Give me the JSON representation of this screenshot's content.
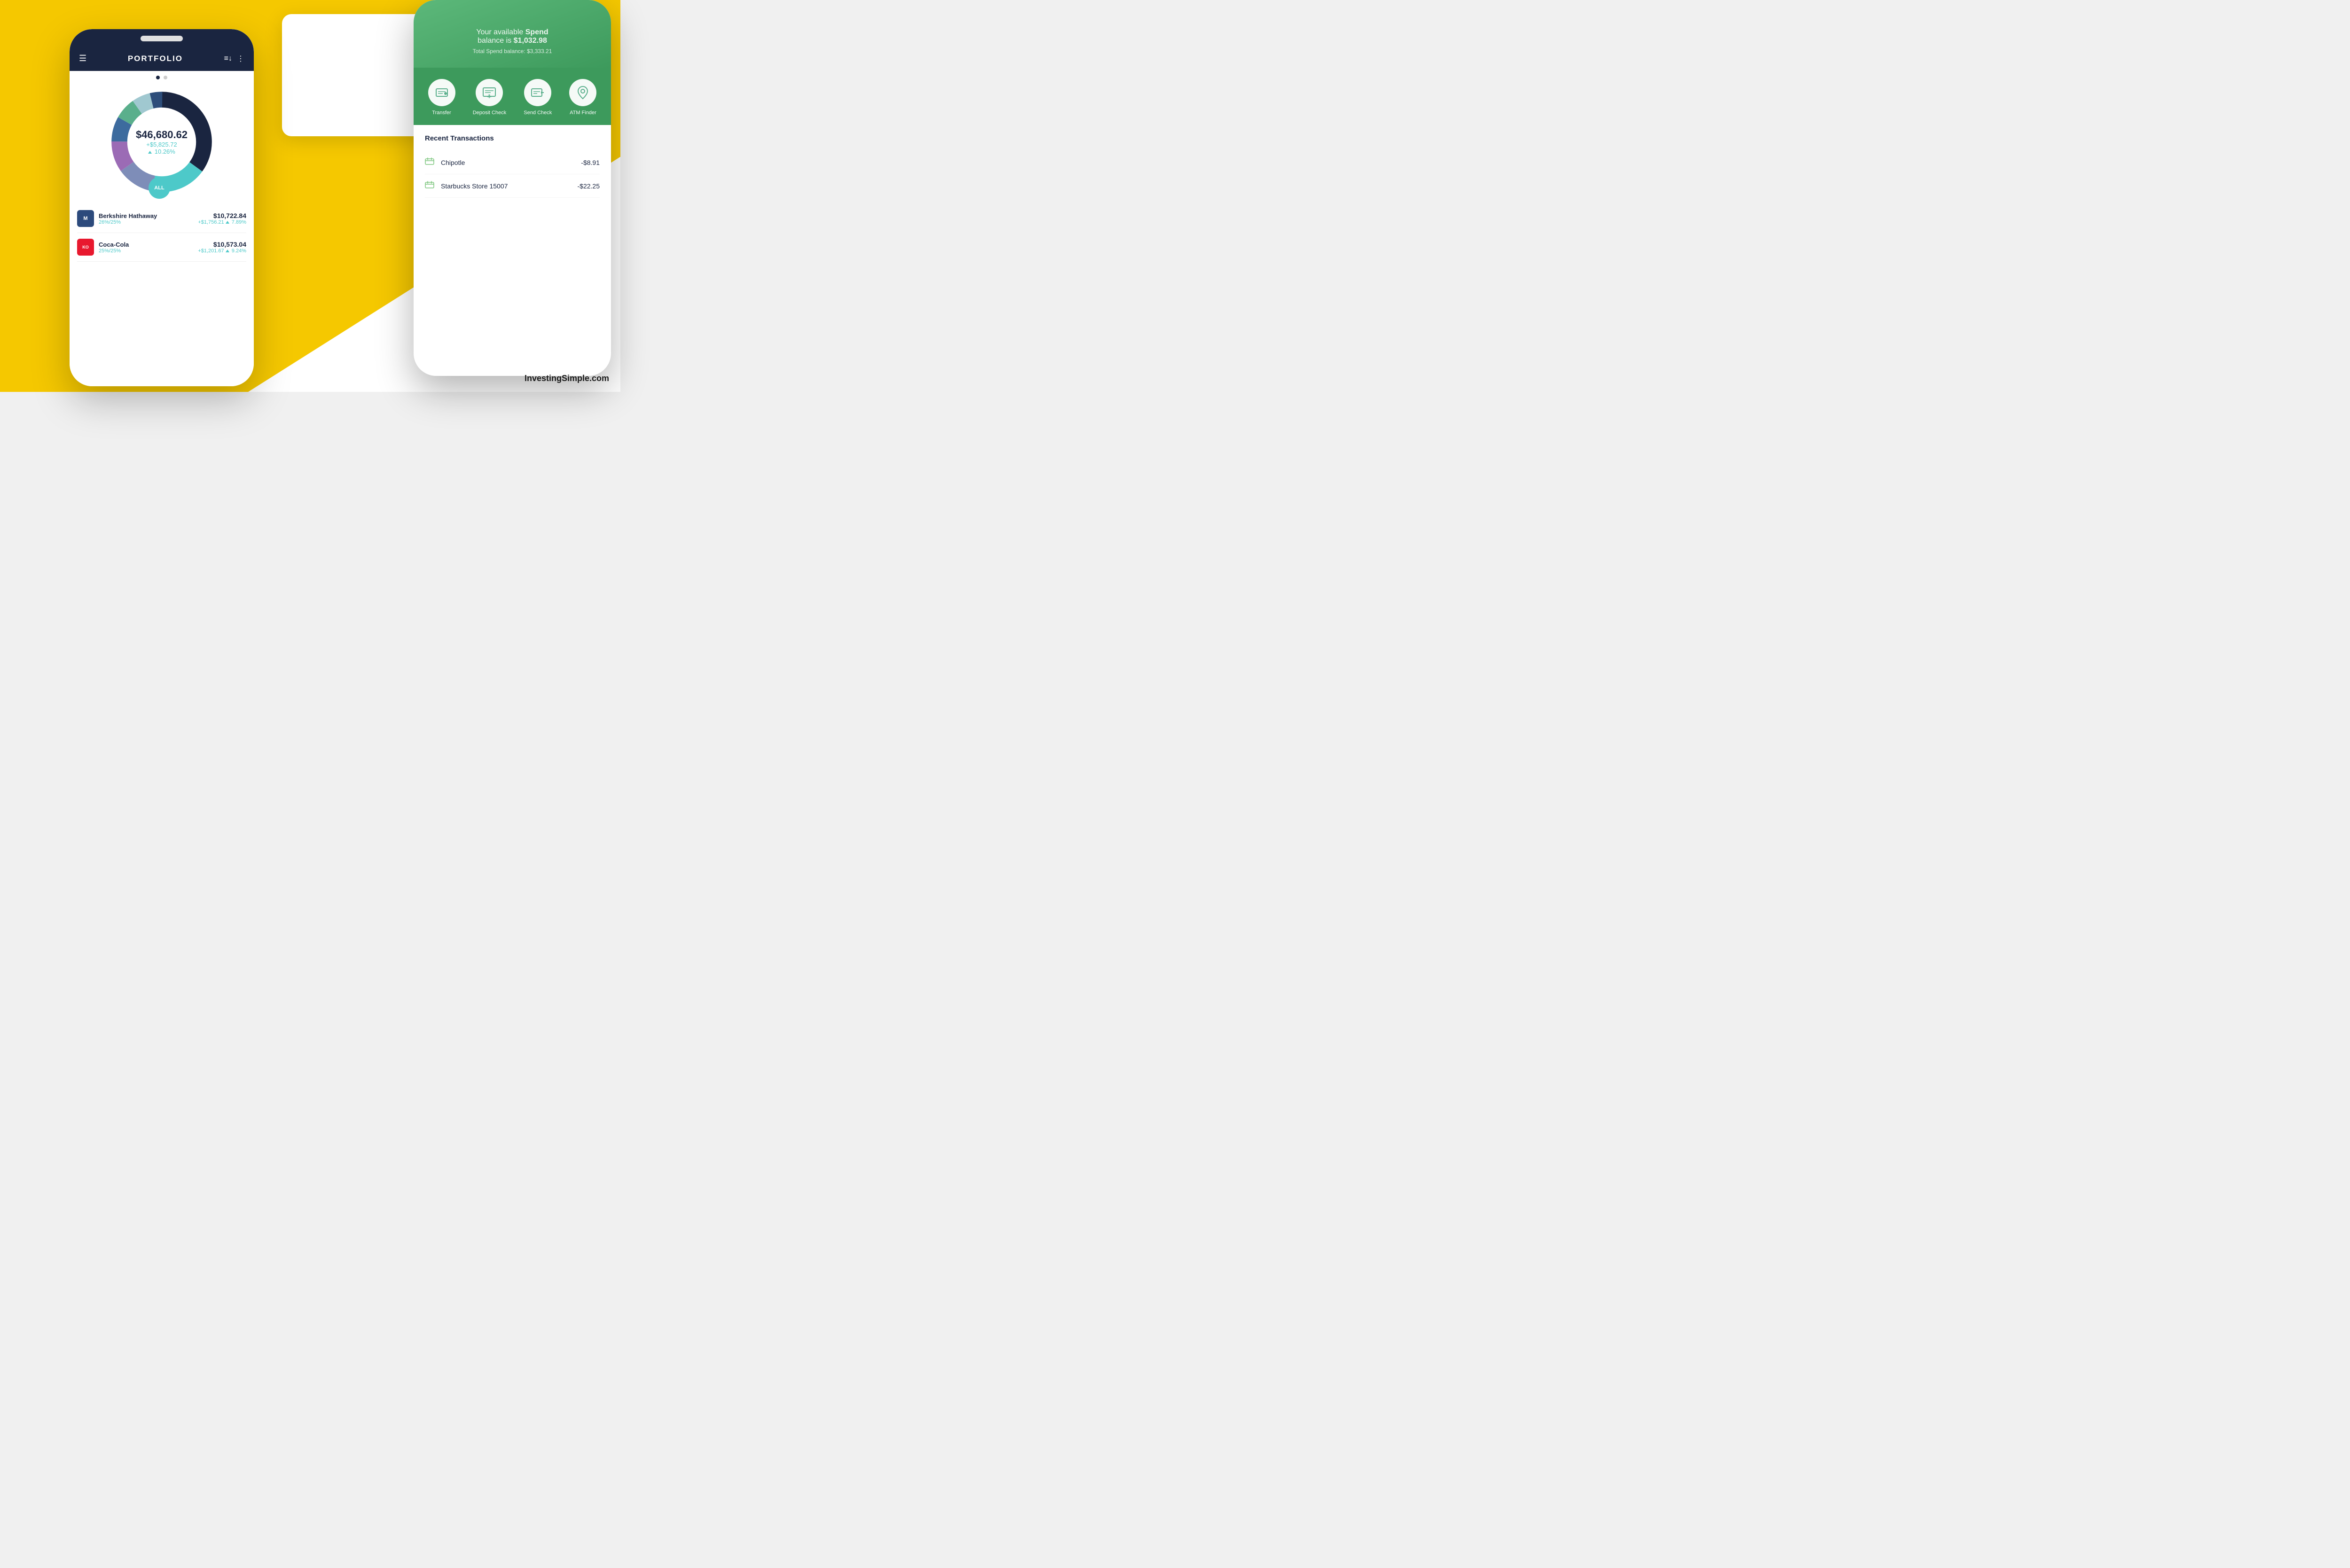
{
  "background": {
    "yellow": "#F5C800",
    "white": "#ffffff"
  },
  "site_credit": "InvestingSimple.com",
  "left_phone": {
    "title": "PORTFOLIO",
    "donut": {
      "total_value": "$46,680.62",
      "gain_value": "+$5,825.72",
      "gain_percent": "10.26%",
      "segments": [
        {
          "color": "#1a2540",
          "percent": 35
        },
        {
          "color": "#4dc9c9",
          "percent": 18
        },
        {
          "color": "#7e8db8",
          "percent": 12
        },
        {
          "color": "#9b6bb5",
          "percent": 10
        },
        {
          "color": "#3d6b9e",
          "percent": 8
        },
        {
          "color": "#5aaf8c",
          "percent": 7
        },
        {
          "color": "#a0c8d0",
          "percent": 6
        },
        {
          "color": "#2d4d7a",
          "percent": 4
        }
      ]
    },
    "all_button_label": "ALL",
    "stocks": [
      {
        "ticker": "M",
        "logo_bg": "#2c4a7c",
        "name": "Berkshire Hathaway",
        "allocation": "26%/25%",
        "price": "$10,722.84",
        "change": "+$1,756.21",
        "change_percent": "7.89%"
      },
      {
        "ticker": "KO",
        "logo_bg": "#e8182e",
        "name": "Coca-Cola",
        "allocation": "25%/25%",
        "price": "$10,573.04",
        "change": "+$1,201.67",
        "change_percent": "9.24%"
      }
    ]
  },
  "right_phone": {
    "header": {
      "subtitle_text": "Your available",
      "subtitle_bold": "Spend",
      "subtitle_suffix": "balance is",
      "available_amount": "$1,032.98",
      "total_label": "Total Spend balance: $3,333.21"
    },
    "actions": [
      {
        "label": "Transfer",
        "icon": "💵"
      },
      {
        "label": "Deposit Check",
        "icon": "🧾"
      },
      {
        "label": "Send Check",
        "icon": "📋"
      },
      {
        "label": "ATM Finder",
        "icon": "📍"
      }
    ],
    "transactions_title": "Recent Transactions",
    "transactions": [
      {
        "name": "Chipotle",
        "amount": "-$8.91"
      },
      {
        "name": "Starbucks Store 15007",
        "amount": "-$22.25"
      }
    ]
  }
}
